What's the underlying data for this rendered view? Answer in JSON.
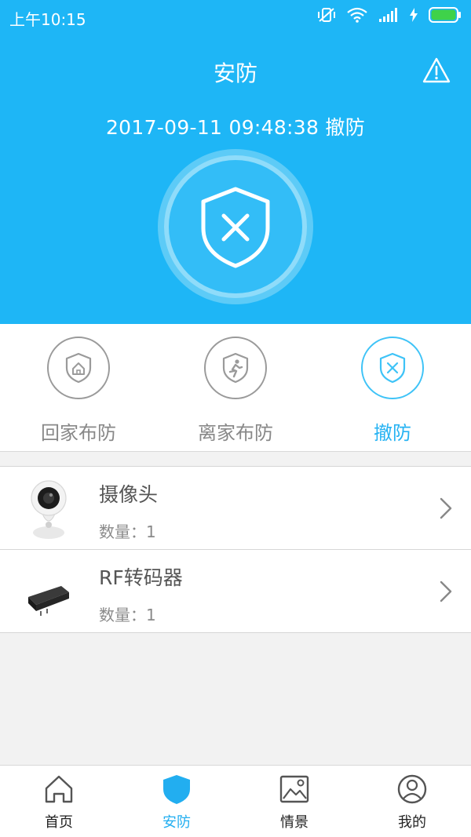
{
  "status_bar": {
    "time": "上午10:15"
  },
  "header": {
    "title": "安防",
    "alert_icon": "warning-icon"
  },
  "security": {
    "timestamp": "2017-09-11 09:48:38 撤防",
    "state_icon": "shield-x-icon"
  },
  "colors": {
    "brand": "#1eb6f6",
    "active": "#27b3f3",
    "text_muted": "#888888"
  },
  "modes": [
    {
      "label": "回家布防",
      "icon": "shield-home-icon",
      "active": false
    },
    {
      "label": "离家布防",
      "icon": "shield-runner-icon",
      "active": false
    },
    {
      "label": "撤防",
      "icon": "shield-x-icon",
      "active": true
    }
  ],
  "devices": [
    {
      "name": "摄像头",
      "count": "数量：1",
      "icon": "camera-icon"
    },
    {
      "name": "RF转码器",
      "count": "数量：1",
      "icon": "rf-transcoder-icon"
    }
  ],
  "tabs": [
    {
      "label": "首页",
      "icon": "home-icon",
      "active": false
    },
    {
      "label": "安防",
      "icon": "shield-icon",
      "active": true
    },
    {
      "label": "情景",
      "icon": "scene-image-icon",
      "active": false
    },
    {
      "label": "我的",
      "icon": "user-icon",
      "active": false
    }
  ]
}
